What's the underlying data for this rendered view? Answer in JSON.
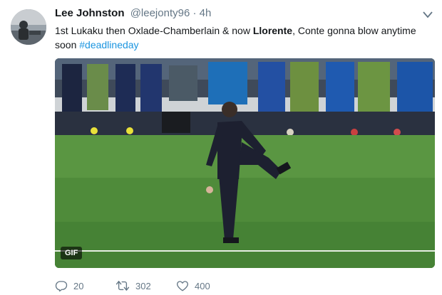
{
  "tweet": {
    "author": {
      "name": "Lee Johnston",
      "handle": "@leejonty96",
      "separator": "·",
      "time": "4h"
    },
    "text": {
      "part1": "1st Lukaku then Oxlade-Chamberlain & now ",
      "bold": "Llorente",
      "part2": ", Conte gonna blow anytime soon ",
      "hashtag": "#deadlineday"
    },
    "media": {
      "badge": "GIF"
    },
    "actions": {
      "replies": "20",
      "retweets": "302",
      "likes": "400"
    }
  },
  "colors": {
    "link": "#1b95e0",
    "secondary_text": "#657786",
    "primary_text": "#14171a"
  },
  "icons": {
    "reply": "reply-icon",
    "retweet": "retweet-icon",
    "like": "heart-icon",
    "menu": "chevron-down-icon"
  }
}
